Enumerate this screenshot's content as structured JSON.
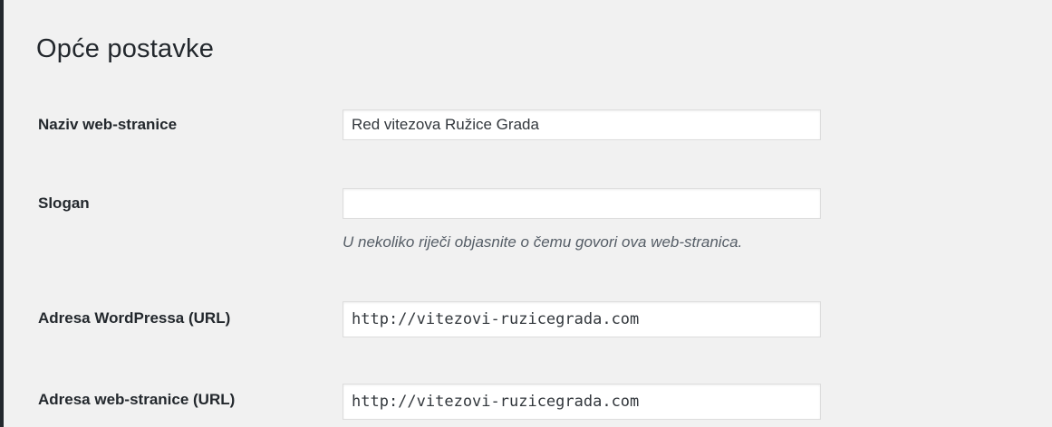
{
  "page": {
    "title": "Opće postavke"
  },
  "settings": {
    "site_title": {
      "label": "Naziv web-stranice",
      "value": "Red vitezova Ružice Grada"
    },
    "tagline": {
      "label": "Slogan",
      "value": "",
      "description": "U nekoliko riječi objasnite o čemu govori ova web-stranica."
    },
    "wordpress_address": {
      "label": "Adresa WordPressa (URL)",
      "value": "http://vitezovi-ruzicegrada.com"
    },
    "site_address": {
      "label": "Adresa web-stranice (URL)",
      "value": "http://vitezovi-ruzicegrada.com"
    }
  }
}
